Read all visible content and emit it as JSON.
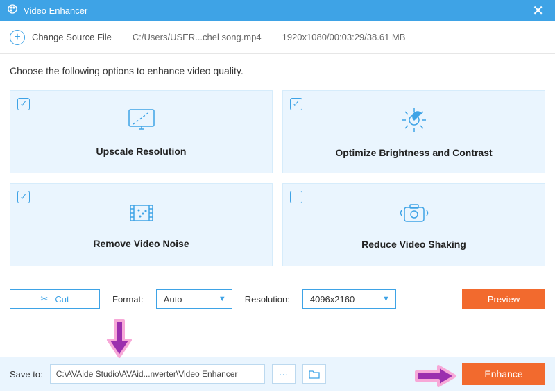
{
  "titlebar": {
    "title": "Video Enhancer"
  },
  "source": {
    "change_label": "Change Source File",
    "path": "C:/Users/USER...chel song.mp4",
    "info": "1920x1080/00:03:29/38.61 MB"
  },
  "instruction": "Choose the following options to enhance video quality.",
  "options": [
    {
      "label": "Upscale Resolution",
      "checked": true
    },
    {
      "label": "Optimize Brightness and Contrast",
      "checked": true
    },
    {
      "label": "Remove Video Noise",
      "checked": true
    },
    {
      "label": "Reduce Video Shaking",
      "checked": false
    }
  ],
  "controls": {
    "cut_label": "Cut",
    "format_label": "Format:",
    "format_value": "Auto",
    "resolution_label": "Resolution:",
    "resolution_value": "4096x2160",
    "preview_label": "Preview"
  },
  "bottom": {
    "save_label": "Save to:",
    "save_path": "C:\\AVAide Studio\\AVAid...nverter\\Video Enhancer",
    "more_label": "···",
    "enhance_label": "Enhance"
  }
}
